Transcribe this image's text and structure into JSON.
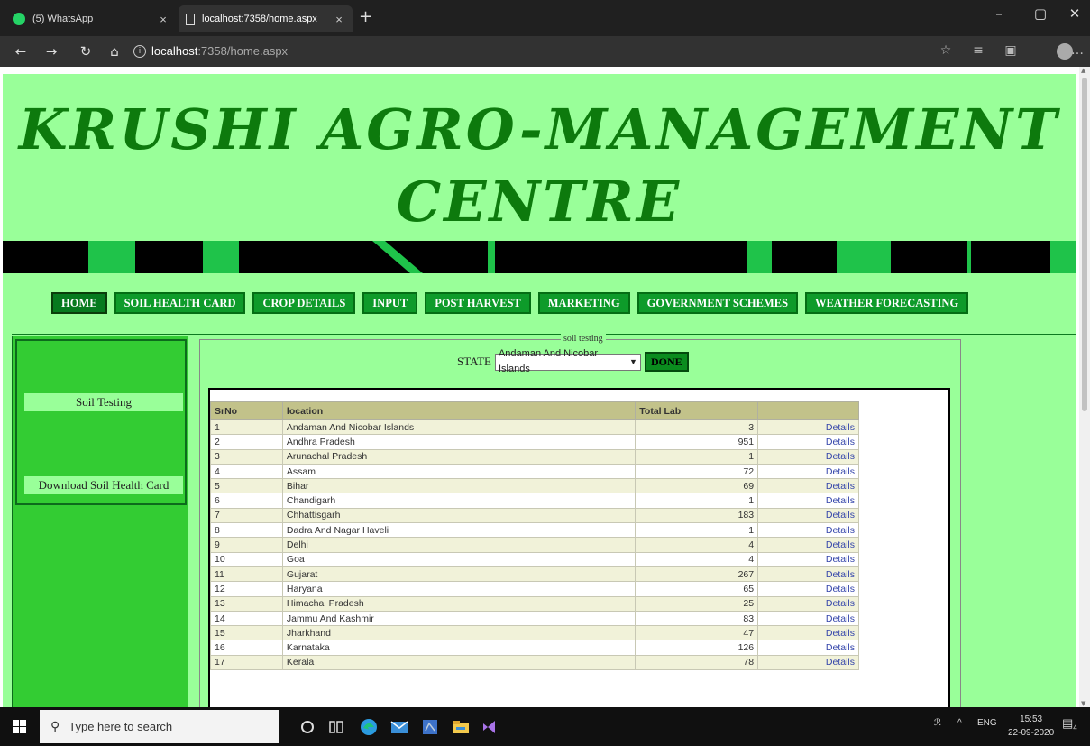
{
  "browser": {
    "tabs": [
      {
        "title": "(5) WhatsApp",
        "icon": "whatsapp-icon"
      },
      {
        "title": "localhost:7358/home.aspx",
        "icon": "page-icon"
      }
    ],
    "url_host": "localhost",
    "url_rest": ":7358/home.aspx"
  },
  "page": {
    "title_line1": "KRUSHI AGRO-MANAGEMENT",
    "title_line2": "CENTRE",
    "menu": [
      "HOME",
      "SOIL HEALTH CARD",
      "CROP DETAILS",
      "INPUT",
      "POST HARVEST",
      "MARKETING",
      "GOVERNMENT SCHEMES",
      "WEATHER FORECASTING"
    ],
    "sidebar": [
      "Soil Testing",
      "Download Soil Health Card"
    ],
    "fieldset_legend": "soil testing",
    "state_label": "STATE",
    "state_selected": "Andaman And Nicobar Islands",
    "done_label": "DONE",
    "table": {
      "headers": [
        "SrNo",
        "location",
        "Total Lab",
        ""
      ],
      "details_label": "Details",
      "rows": [
        {
          "sr": "1",
          "loc": "Andaman And Nicobar Islands",
          "labs": "3"
        },
        {
          "sr": "2",
          "loc": "Andhra Pradesh",
          "labs": "951"
        },
        {
          "sr": "3",
          "loc": "Arunachal Pradesh",
          "labs": "1"
        },
        {
          "sr": "4",
          "loc": "Assam",
          "labs": "72"
        },
        {
          "sr": "5",
          "loc": "Bihar",
          "labs": "69"
        },
        {
          "sr": "6",
          "loc": "Chandigarh",
          "labs": "1"
        },
        {
          "sr": "7",
          "loc": "Chhattisgarh",
          "labs": "183"
        },
        {
          "sr": "8",
          "loc": "Dadra And Nagar Haveli",
          "labs": "1"
        },
        {
          "sr": "9",
          "loc": "Delhi",
          "labs": "4"
        },
        {
          "sr": "10",
          "loc": "Goa",
          "labs": "4"
        },
        {
          "sr": "11",
          "loc": "Gujarat",
          "labs": "267"
        },
        {
          "sr": "12",
          "loc": "Haryana",
          "labs": "65"
        },
        {
          "sr": "13",
          "loc": "Himachal Pradesh",
          "labs": "25"
        },
        {
          "sr": "14",
          "loc": "Jammu And Kashmir",
          "labs": "83"
        },
        {
          "sr": "15",
          "loc": "Jharkhand",
          "labs": "47"
        },
        {
          "sr": "16",
          "loc": "Karnataka",
          "labs": "126"
        },
        {
          "sr": "17",
          "loc": "Kerala",
          "labs": "78"
        }
      ]
    }
  },
  "taskbar": {
    "search_placeholder": "Type here to search",
    "lang": "ENG",
    "time": "15:53",
    "date": "22-09-2020",
    "notif_count": "4"
  },
  "colors": {
    "page_bg": "#99ff99",
    "title_green": "#0d7a0d",
    "menu_green": "#0e9b2a",
    "sidebar_green": "#33cc33",
    "stripe_green": "#1fc34a"
  }
}
